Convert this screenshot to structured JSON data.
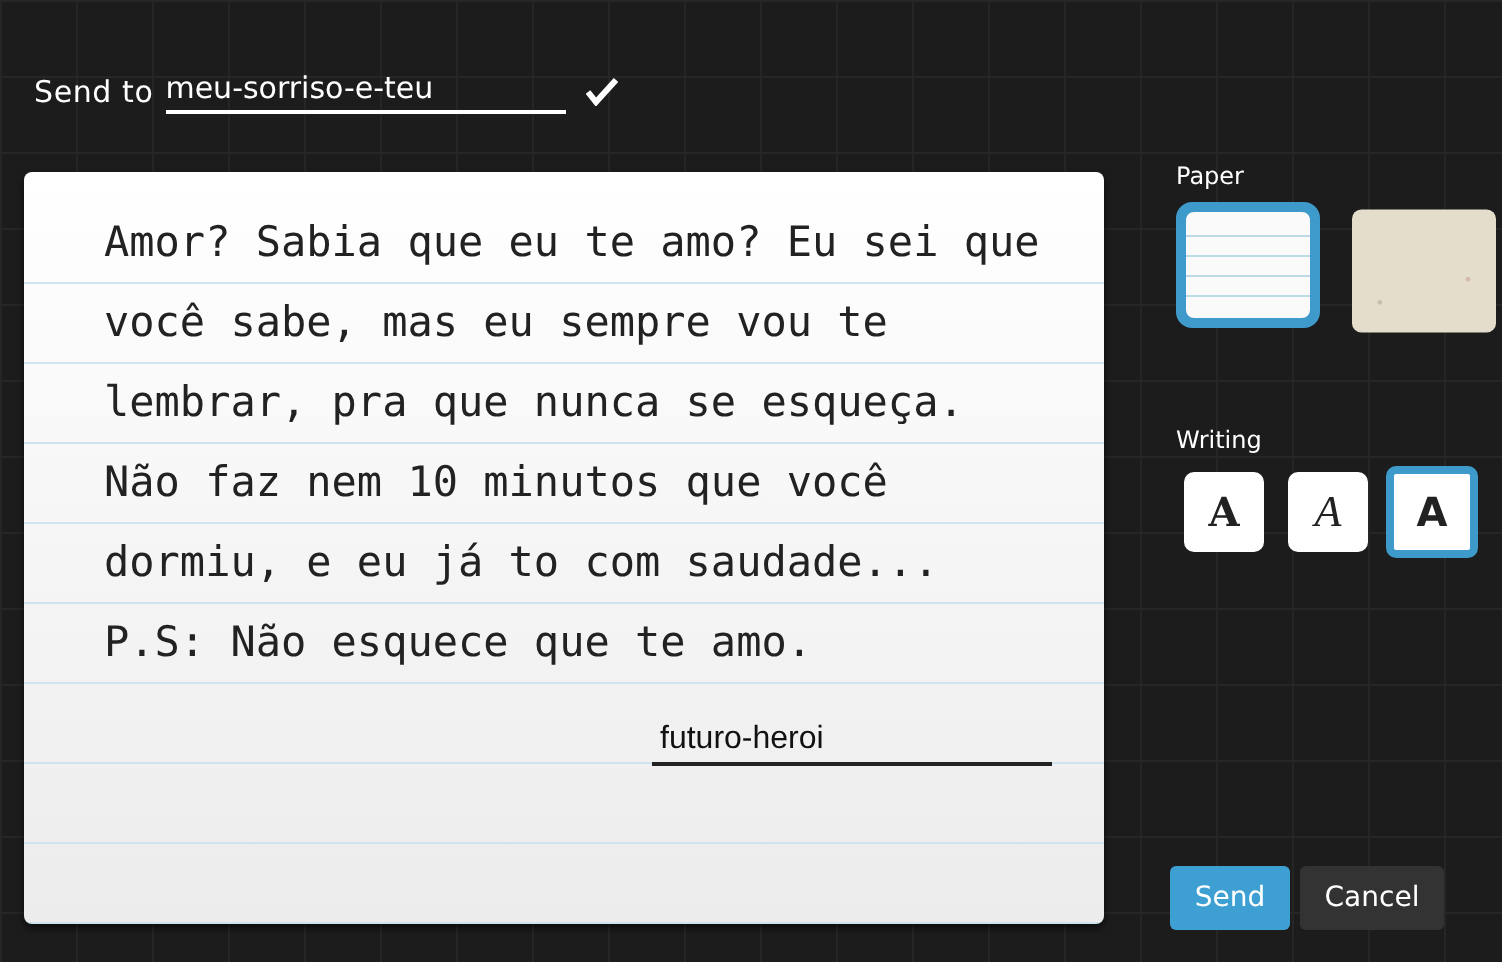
{
  "send_to": {
    "label": "Send to",
    "value": "meu-sorriso-e-teu",
    "confirmed": true
  },
  "letter": {
    "lines": [
      "Amor? Sabia que eu te amo? Eu sei que",
      "você sabe, mas eu sempre vou te",
      "lembrar, pra que nunca se esqueça.",
      "Não faz nem 10 minutos que você",
      "dormiu, e eu já to com saudade...",
      "P.S: Não esquece que te amo."
    ],
    "signature": "futuro-heroi"
  },
  "paper": {
    "label": "Paper",
    "options": [
      {
        "kind": "lined",
        "selected": true
      },
      {
        "kind": "parchment",
        "selected": false
      }
    ]
  },
  "writing": {
    "label": "Writing",
    "options": [
      {
        "kind": "slab",
        "text": "A",
        "selected": false
      },
      {
        "kind": "sketch",
        "text": "A",
        "selected": false
      },
      {
        "kind": "sans",
        "text": "A",
        "selected": true
      }
    ]
  },
  "buttons": [
    {
      "kind": "primary",
      "label": "Send"
    },
    {
      "kind": "secondary",
      "label": "Cancel"
    }
  ]
}
